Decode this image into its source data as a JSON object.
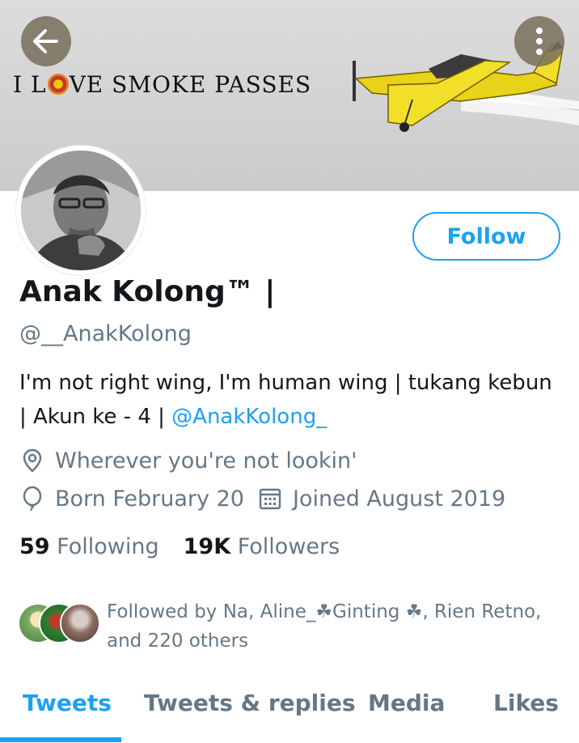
{
  "banner": {
    "text_before": "I L",
    "text_after": "VE SMOKE PASSES"
  },
  "profile": {
    "name": "Anak Kolong™ |",
    "handle": "@__AnakKolong",
    "bio_text": "I'm not right wing,  I'm human wing | tukang kebun | Akun ke - 4 | ",
    "bio_mention": "@AnakKolong_",
    "location": "Wherever you're not lookin'",
    "born": "Born February 20",
    "joined": "Joined August 2019",
    "follow_label": "Follow"
  },
  "stats": {
    "following_count": "59",
    "following_label": "Following",
    "followers_count": "19K",
    "followers_label": "Followers"
  },
  "followed_by": {
    "text": "Followed by Na,  Aline_☘Ginting ☘, Rien Retno, and 220 others"
  },
  "tabs": [
    {
      "label": "Tweets",
      "active": true
    },
    {
      "label": "Tweets & replies",
      "active": false
    },
    {
      "label": "Media",
      "active": false
    },
    {
      "label": "Likes",
      "active": false
    }
  ],
  "colors": {
    "accent": "#1da1f2",
    "secondary_text": "#657786",
    "primary_text": "#14171a"
  }
}
